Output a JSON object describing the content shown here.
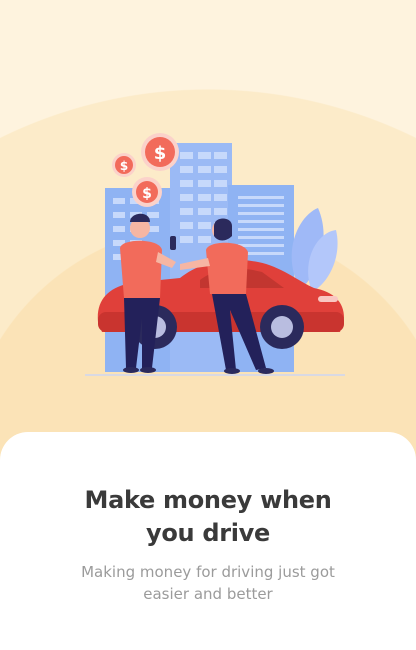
{
  "onboarding": {
    "title_line1": "Make money when",
    "title_line2": "you drive",
    "subtitle_line1": "Making money for driving just got",
    "subtitle_line2": "easier and better",
    "illustration_icons": [
      "dollar-coin-icon",
      "building-icon",
      "car-icon",
      "person-icon",
      "plant-icon"
    ],
    "colors": {
      "background": "#fef3de",
      "accent": "#f26b5b",
      "car": "#e0403a",
      "buildings": "#8fb3f3",
      "title": "#3a3a3a",
      "subtitle": "#9b9b9b"
    },
    "currency_symbol": "$"
  }
}
